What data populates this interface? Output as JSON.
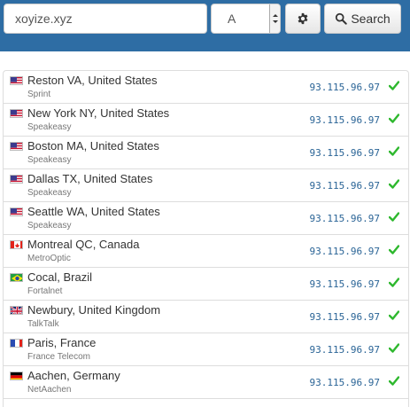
{
  "search": {
    "domain_value": "xoyize.xyz",
    "record_type": "A",
    "settings_icon": "gear-icon",
    "search_label": "Search",
    "search_icon": "search-icon"
  },
  "colors": {
    "header_bg": "#2e6da4",
    "ip_text": "#2a6496",
    "check": "#2eb82e"
  },
  "results": [
    {
      "location": "Reston VA, United States",
      "isp": "Sprint",
      "ip": "93.115.96.97",
      "flag": "us",
      "status": "ok"
    },
    {
      "location": "New York NY, United States",
      "isp": "Speakeasy",
      "ip": "93.115.96.97",
      "flag": "us",
      "status": "ok"
    },
    {
      "location": "Boston MA, United States",
      "isp": "Speakeasy",
      "ip": "93.115.96.97",
      "flag": "us",
      "status": "ok"
    },
    {
      "location": "Dallas TX, United States",
      "isp": "Speakeasy",
      "ip": "93.115.96.97",
      "flag": "us",
      "status": "ok"
    },
    {
      "location": "Seattle WA, United States",
      "isp": "Speakeasy",
      "ip": "93.115.96.97",
      "flag": "us",
      "status": "ok"
    },
    {
      "location": "Montreal QC, Canada",
      "isp": "MetroOptic",
      "ip": "93.115.96.97",
      "flag": "ca",
      "status": "ok"
    },
    {
      "location": "Cocal, Brazil",
      "isp": "Fortalnet",
      "ip": "93.115.96.97",
      "flag": "br",
      "status": "ok"
    },
    {
      "location": "Newbury, United Kingdom",
      "isp": "TalkTalk",
      "ip": "93.115.96.97",
      "flag": "gb",
      "status": "ok"
    },
    {
      "location": "Paris, France",
      "isp": "France Telecom",
      "ip": "93.115.96.97",
      "flag": "fr",
      "status": "ok"
    },
    {
      "location": "Aachen, Germany",
      "isp": "NetAachen",
      "ip": "93.115.96.97",
      "flag": "de",
      "status": "ok"
    }
  ]
}
